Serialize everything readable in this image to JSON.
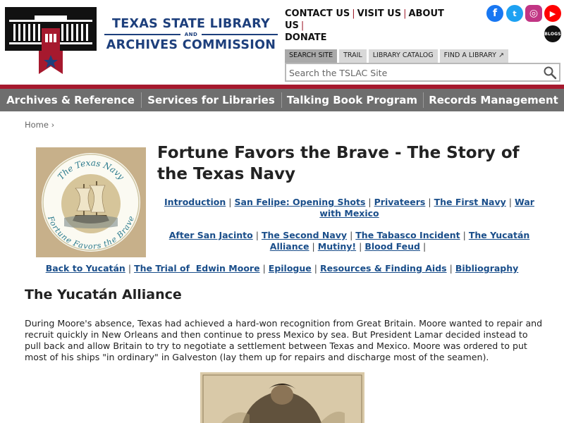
{
  "brand": {
    "line1": "TEXAS STATE LIBRARY",
    "and": "AND",
    "line2": "ARCHIVES COMMISSION",
    "colors": {
      "navy": "#1d3f7c",
      "red": "#a6192e"
    }
  },
  "toplinks": {
    "contact": "CONTACT US",
    "visit": "VISIT US",
    "about": "ABOUT US",
    "donate": "DONATE",
    "separator": "|"
  },
  "social": {
    "facebook": "f",
    "twitter": "t",
    "instagram": "◎",
    "youtube": "▶",
    "blogs": "BLOGS"
  },
  "search": {
    "tabs": [
      "SEARCH SITE",
      "TRAIL",
      "LIBRARY CATALOG",
      "FIND A LIBRARY ↗"
    ],
    "active_tab": "SEARCH SITE",
    "placeholder": "Search the TSLAC Site",
    "button_icon": "magnifier-icon"
  },
  "nav": {
    "items": [
      "Archives & Reference",
      "Services for Libraries",
      "Talking Book Program",
      "Records Management"
    ]
  },
  "breadcrumb": {
    "home": "Home",
    "sep": "›"
  },
  "page": {
    "title": "Fortune Favors the Brave - The Story of the Texas Navy",
    "image_text_top": "The Texas Navy",
    "image_text_bottom": "Fortune Favors the Brave",
    "subnav1": [
      "Introduction",
      "San Felipe: Opening Shots",
      "Privateers",
      "The First Navy",
      "War with Mexico"
    ],
    "subnav2": [
      "After San Jacinto",
      "The Second Navy",
      "The Tabasco Incident",
      "The Yucatán Alliance",
      "Mutiny!",
      "Blood Feud"
    ],
    "subnav3": [
      "Back to Yucatán",
      "The Trial of  Edwin Moore",
      "Epilogue",
      "Resources & Finding Aids",
      "Bibliography"
    ],
    "section_title": "The Yucatán Alliance",
    "body": "During Moore's absence, Texas had achieved a hard-won recognition from Great Britain. Moore wanted to repair and recruit quickly in New Orleans and then continue to press Mexico by sea. But President Lamar decided instead to pull back and allow Britain to try to negotiate a settlement between Texas and Mexico. Moore was ordered to put most of his ships \"in ordinary\" in Galveston (lay them up for repairs and discharge most of the seamen)."
  }
}
